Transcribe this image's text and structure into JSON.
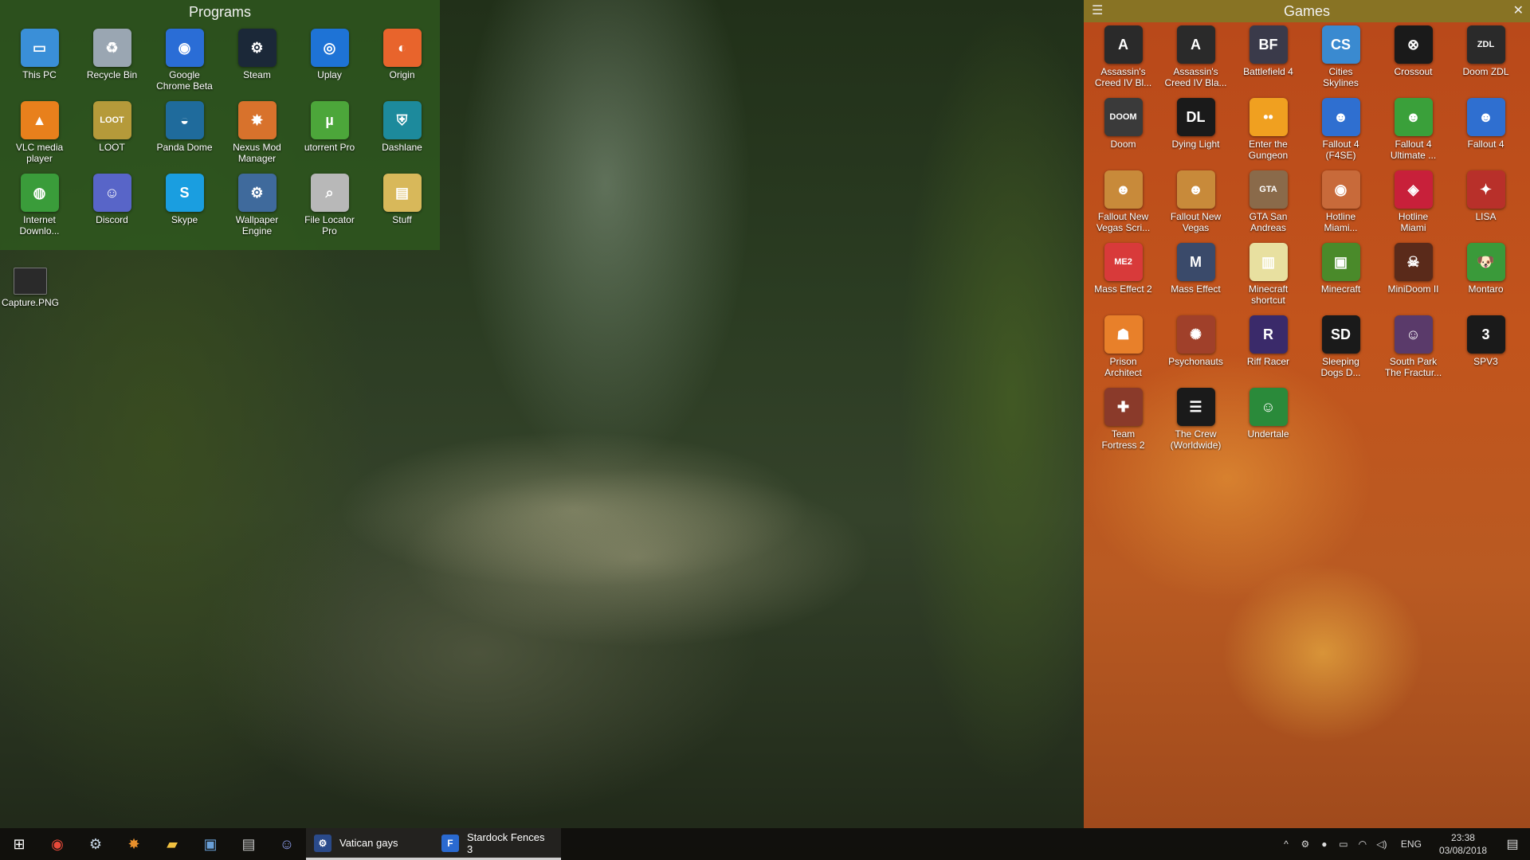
{
  "programs": {
    "title": "Programs",
    "items": [
      {
        "label": "This PC",
        "icon": "monitor-icon",
        "color": "#3a8fd8",
        "glyph": "▭"
      },
      {
        "label": "Recycle Bin",
        "icon": "recycle-bin-icon",
        "color": "#9aa6b2",
        "glyph": "♻"
      },
      {
        "label": "Google\nChrome Beta",
        "icon": "chrome-beta-icon",
        "color": "#2a6dd6",
        "glyph": "◉"
      },
      {
        "label": "Steam",
        "icon": "steam-icon",
        "color": "#1b2838",
        "glyph": "⚙"
      },
      {
        "label": "Uplay",
        "icon": "uplay-icon",
        "color": "#1e73d6",
        "glyph": "◎"
      },
      {
        "label": "Origin",
        "icon": "origin-icon",
        "color": "#e8642c",
        "glyph": "◐"
      },
      {
        "label": "VLC media\nplayer",
        "icon": "vlc-cone-icon",
        "color": "#e8801c",
        "glyph": "▲"
      },
      {
        "label": "LOOT",
        "icon": "loot-icon",
        "color": "#b59a3a",
        "glyph": "LOOT"
      },
      {
        "label": "Panda Dome",
        "icon": "panda-dome-icon",
        "color": "#1f6b9c",
        "glyph": "◒"
      },
      {
        "label": "Nexus Mod\nManager",
        "icon": "nexus-icon",
        "color": "#d8722c",
        "glyph": "✸"
      },
      {
        "label": "utorrent Pro",
        "icon": "utorrent-icon",
        "color": "#4ca63a",
        "glyph": "µ"
      },
      {
        "label": "Dashlane",
        "icon": "dashlane-shield-icon",
        "color": "#1d8a9c",
        "glyph": "⛨"
      },
      {
        "label": "Internet\nDownlo...",
        "icon": "internet-download-manager-icon",
        "color": "#3a9c3a",
        "glyph": "◍"
      },
      {
        "label": "Discord",
        "icon": "discord-icon",
        "color": "#5865c8",
        "glyph": "☺"
      },
      {
        "label": "Skype",
        "icon": "skype-icon",
        "color": "#1a9ee0",
        "glyph": "S"
      },
      {
        "label": "Wallpaper\nEngine",
        "icon": "wallpaper-engine-icon",
        "color": "#3f6a9c",
        "glyph": "⚙"
      },
      {
        "label": "File Locator\nPro",
        "icon": "magnifier-icon",
        "color": "#b8b8b8",
        "glyph": "⌕"
      },
      {
        "label": "Stuff",
        "icon": "folder-icon",
        "color": "#d8b85a",
        "glyph": "▤"
      }
    ]
  },
  "desktop": {
    "file_label": "Capture.PNG"
  },
  "games": {
    "title": "Games",
    "menu_glyph": "☰",
    "close_glyph": "✕",
    "items": [
      {
        "label": "Assassin's\nCreed IV Bl...",
        "icon": "assassins-creed-icon",
        "color": "#2a2a2a",
        "glyph": "A"
      },
      {
        "label": "Assassin's\nCreed IV Bla...",
        "icon": "assassins-creed-icon",
        "color": "#2a2a2a",
        "glyph": "A"
      },
      {
        "label": "Battlefield 4",
        "icon": "battlefield-icon",
        "color": "#3a3a4a",
        "glyph": "BF"
      },
      {
        "label": "Cities\nSkylines",
        "icon": "cities-skylines-icon",
        "color": "#3a8ad0",
        "glyph": "CS"
      },
      {
        "label": "Crossout",
        "icon": "crossout-icon",
        "color": "#1a1a1a",
        "glyph": "⊗"
      },
      {
        "label": "Doom ZDL",
        "icon": "doom-zdl-icon",
        "color": "#2a2a2a",
        "glyph": "ZDL"
      },
      {
        "label": "Doom",
        "icon": "doom-icon",
        "color": "#3a3a3a",
        "glyph": "DOOM"
      },
      {
        "label": "Dying Light",
        "icon": "dying-light-icon",
        "color": "#1a1a1a",
        "glyph": "DL"
      },
      {
        "label": "Enter the\nGungeon",
        "icon": "gungeon-icon",
        "color": "#f0a020",
        "glyph": "••"
      },
      {
        "label": "Fallout 4\n(F4SE)",
        "icon": "vault-boy-icon",
        "color": "#2f6fd0",
        "glyph": "☻"
      },
      {
        "label": "Fallout 4\nUltimate ...",
        "icon": "vault-boy-icon",
        "color": "#3aa03a",
        "glyph": "☻"
      },
      {
        "label": "Fallout 4",
        "icon": "vault-boy-icon",
        "color": "#2f6fd0",
        "glyph": "☻"
      },
      {
        "label": "Fallout New\nVegas Scri...",
        "icon": "vault-boy-icon",
        "color": "#c88a3a",
        "glyph": "☻"
      },
      {
        "label": "Fallout New\nVegas",
        "icon": "vault-boy-icon",
        "color": "#c88a3a",
        "glyph": "☻"
      },
      {
        "label": "GTA San\nAndreas",
        "icon": "gta-icon",
        "color": "#8a6a4a",
        "glyph": "GTA"
      },
      {
        "label": "Hotline\nMiami...",
        "icon": "hotline-miami-icon",
        "color": "#c86a3a",
        "glyph": "◉"
      },
      {
        "label": "Hotline\nMiami",
        "icon": "hotline-miami-icon",
        "color": "#c8203a",
        "glyph": "◈"
      },
      {
        "label": "LISA",
        "icon": "lisa-icon",
        "color": "#b8302a",
        "glyph": "✦"
      },
      {
        "label": "Mass Effect 2",
        "icon": "mass-effect-icon",
        "color": "#d83a3a",
        "glyph": "ME2"
      },
      {
        "label": "Mass Effect",
        "icon": "mass-effect-icon",
        "color": "#3a4a6a",
        "glyph": "M"
      },
      {
        "label": "Minecraft\nshortcut",
        "icon": "shortcut-icon",
        "color": "#e8e0a0",
        "glyph": "▥"
      },
      {
        "label": "Minecraft",
        "icon": "grass-block-icon",
        "color": "#4a8a2a",
        "glyph": "▣"
      },
      {
        "label": "MiniDoom II",
        "icon": "minidoom-icon",
        "color": "#5a2a1a",
        "glyph": "☠"
      },
      {
        "label": "Montaro",
        "icon": "shiba-dog-icon",
        "color": "#3a9a3a",
        "glyph": "🐶"
      },
      {
        "label": "Prison\nArchitect",
        "icon": "prison-architect-icon",
        "color": "#e8802a",
        "glyph": "☗"
      },
      {
        "label": "Psychonauts",
        "icon": "psychonauts-icon",
        "color": "#a0402a",
        "glyph": "✺"
      },
      {
        "label": "Riff Racer",
        "icon": "riff-racer-icon",
        "color": "#3a2a6a",
        "glyph": "R"
      },
      {
        "label": "Sleeping\nDogs D...",
        "icon": "sleeping-dogs-icon",
        "color": "#1a1a1a",
        "glyph": "SD"
      },
      {
        "label": "South Park\nThe Fractur...",
        "icon": "south-park-icon",
        "color": "#5a3a6a",
        "glyph": "☺"
      },
      {
        "label": "SPV3",
        "icon": "spv3-icon",
        "color": "#1a1a1a",
        "glyph": "3"
      },
      {
        "label": "Team\nFortress 2",
        "icon": "tf2-icon",
        "color": "#8a3a2a",
        "glyph": "✚"
      },
      {
        "label": "The Crew\n(Worldwide)",
        "icon": "the-crew-icon",
        "color": "#1a1a1a",
        "glyph": "☰"
      },
      {
        "label": "Undertale",
        "icon": "undertale-icon",
        "color": "#2a8a3a",
        "glyph": "☺"
      }
    ]
  },
  "taskbar": {
    "pinned": [
      {
        "icon": "windows-start-icon",
        "glyph": "⊞",
        "color": "#ffffff"
      },
      {
        "icon": "chrome-icon",
        "glyph": "◉",
        "color": "#e84a3a"
      },
      {
        "icon": "steam-icon",
        "glyph": "⚙",
        "color": "#c8d8e8"
      },
      {
        "icon": "nexus-icon",
        "glyph": "✸",
        "color": "#e8902c"
      },
      {
        "icon": "file-explorer-icon",
        "glyph": "▰",
        "color": "#f0c040"
      },
      {
        "icon": "control-panel-icon",
        "glyph": "▣",
        "color": "#6aa0d8"
      },
      {
        "icon": "printer-icon",
        "glyph": "▤",
        "color": "#c8c8c8"
      },
      {
        "icon": "discord-icon",
        "glyph": "☺",
        "color": "#8a9ae8"
      }
    ],
    "apps": [
      {
        "label": "Vatican gays",
        "icon": "steam-chat-icon",
        "glyph": "⚙",
        "color": "#2a4a8a"
      },
      {
        "label": "Stardock Fences 3",
        "icon": "fences-icon",
        "glyph": "F",
        "color": "#2a6ad0"
      }
    ],
    "tray": {
      "icons": [
        {
          "icon": "chevron-up-icon",
          "glyph": "^"
        },
        {
          "icon": "steam-tray-icon",
          "glyph": "⚙"
        },
        {
          "icon": "origin-tray-icon",
          "glyph": "●"
        },
        {
          "icon": "battery-icon",
          "glyph": "▭"
        },
        {
          "icon": "wifi-icon",
          "glyph": "◠"
        },
        {
          "icon": "volume-icon",
          "glyph": "◁)"
        }
      ],
      "language": "ENG",
      "time": "23:38",
      "date": "03/08/2018",
      "notification_glyph": "▤"
    }
  }
}
